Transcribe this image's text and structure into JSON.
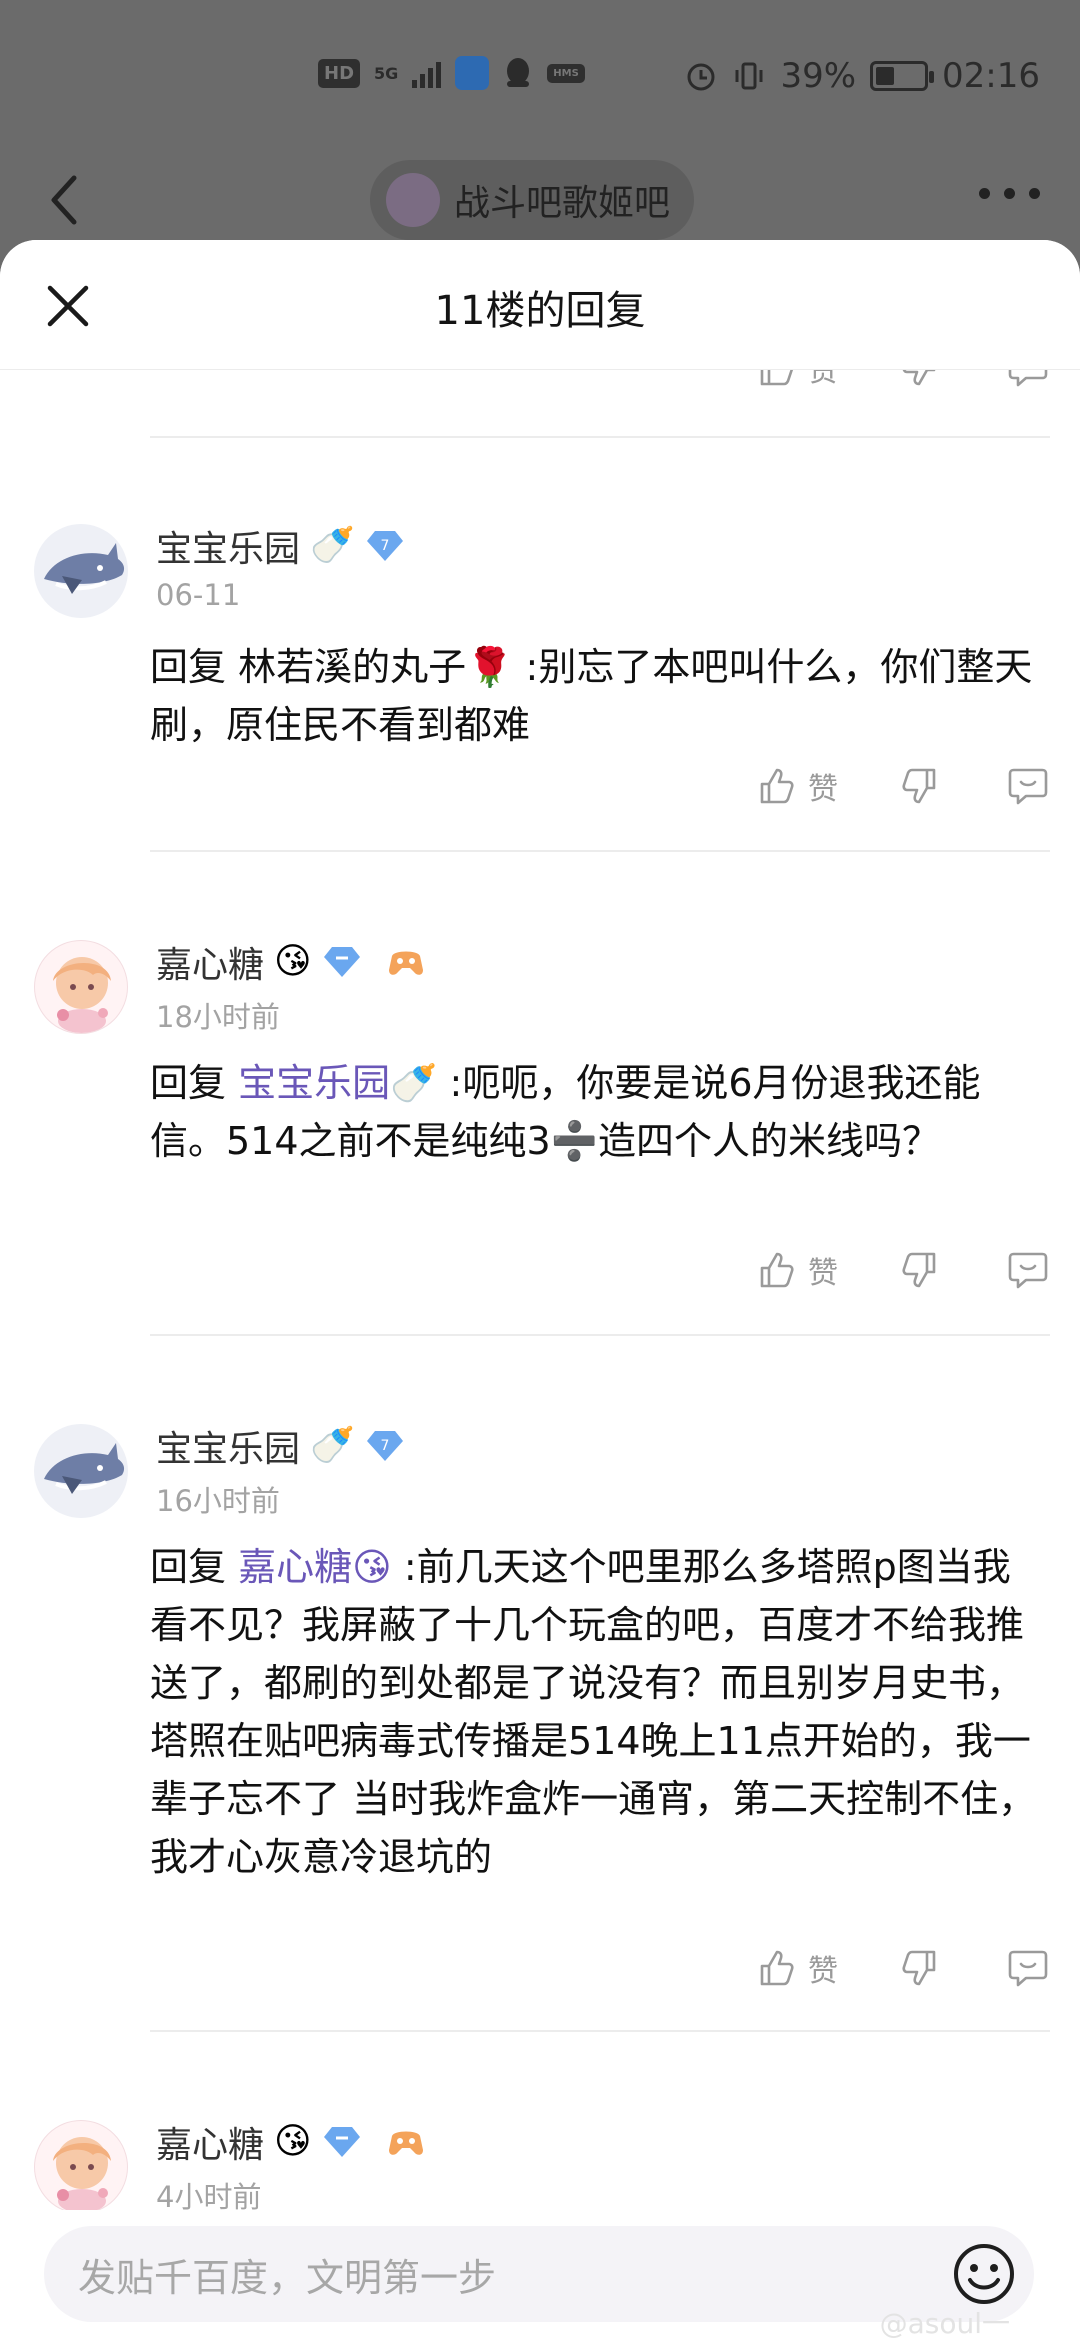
{
  "status_bar": {
    "hd": "HD",
    "net": "5G",
    "battery_text": "39%",
    "battery_level": 0.39,
    "time": "02:16"
  },
  "nav": {
    "forum_name": "战斗吧歌姬吧"
  },
  "sheet": {
    "title": "11楼的回复"
  },
  "actions": {
    "like_label": "赞"
  },
  "comments": [
    {
      "user": "宝宝乐园",
      "user_emoji": "🍼",
      "badge_level": "7",
      "time": "06-11",
      "reply_prefix": "回复",
      "reply_to": "林若溪的丸子🌹",
      "text": ":别忘了本吧叫什么，你们整天刷，原住民不看到都难"
    },
    {
      "user": "嘉心糖",
      "user_emoji": "😘",
      "time": "18小时前",
      "reply_prefix": "回复",
      "reply_to": "宝宝乐园🍼",
      "text": ":呃呃，你要是说6月份退我还能信。514之前不是纯纯3➗造四个人的米线吗？"
    },
    {
      "user": "宝宝乐园",
      "user_emoji": "🍼",
      "badge_level": "7",
      "time": "16小时前",
      "reply_prefix": "回复",
      "reply_to": "嘉心糖😘",
      "text": ":前几天这个吧里那么多塔照p图当我看不见？我屏蔽了十几个玩盒的吧，百度才不给我推送了，都刷的到处都是了说没有？而且别岁月史书，塔照在贴吧病毒式传播是514晚上11点开始的，我一辈子忘不了 当时我炸盒炸一通宵，第二天控制不住，我才心灰意冷退坑的"
    },
    {
      "user": "嘉心糖",
      "user_emoji": "😘",
      "time": "4小时前"
    }
  ],
  "input": {
    "placeholder": "发贴千百度，文明第一步",
    "watermark": "@asoul一"
  }
}
